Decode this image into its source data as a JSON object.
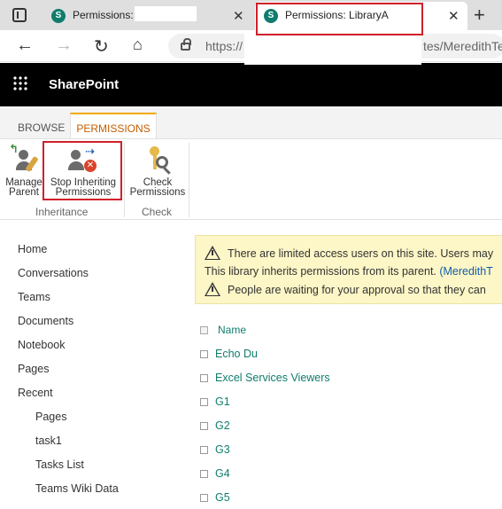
{
  "browser": {
    "tabs": [
      {
        "title": "Permissions:",
        "active": false
      },
      {
        "title": "Permissions: LibraryA",
        "active": true
      }
    ],
    "url_start": "https://",
    "url_end": "tes/MeredithTe"
  },
  "suite": {
    "brand": "SharePoint"
  },
  "ribbon": {
    "tabs": [
      "BROWSE",
      "PERMISSIONS"
    ],
    "buttons": {
      "manage_parent": {
        "line1": "Manage",
        "line2": "Parent"
      },
      "stop_inheriting": {
        "line1": "Stop Inheriting",
        "line2": "Permissions"
      },
      "check_permissions": {
        "line1": "Check",
        "line2": "Permissions"
      }
    },
    "groups": [
      "Inheritance",
      "Check"
    ]
  },
  "nav": {
    "items": [
      "Home",
      "Conversations",
      "Teams",
      "Documents",
      "Notebook",
      "Pages",
      "Recent"
    ],
    "recent_items": [
      "Pages",
      "task1",
      "Tasks List",
      "Teams Wiki Data"
    ]
  },
  "warning": {
    "line1": "There are limited access users on this site. Users may",
    "line2_text": "This library inherits permissions from its parent. ",
    "line2_link": "(MeredithT",
    "line3": "People are waiting for your approval so that they can"
  },
  "list": {
    "header": "Name",
    "rows": [
      "Echo Du",
      "Excel Services Viewers",
      "G1",
      "G2",
      "G3",
      "G4",
      "G5"
    ]
  }
}
